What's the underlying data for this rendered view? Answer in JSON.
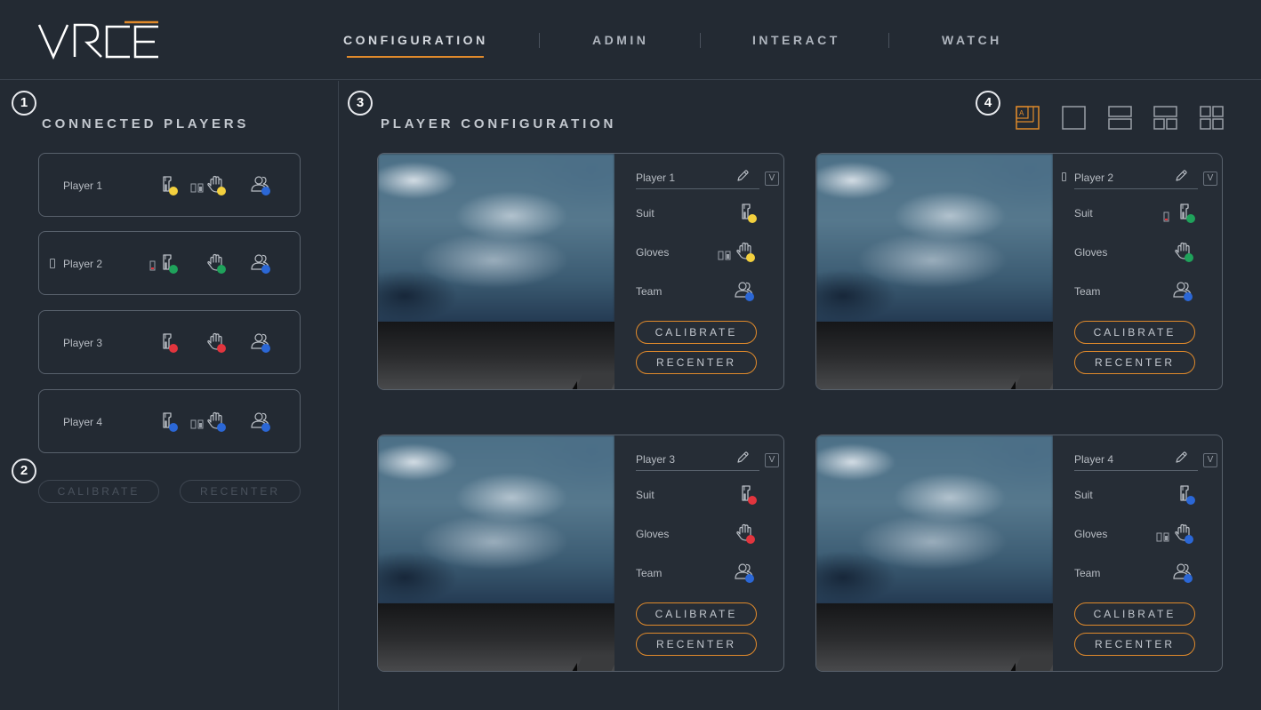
{
  "header": {
    "logo_text": "VREE",
    "nav": [
      {
        "label": "CONFIGURATION",
        "active": true
      },
      {
        "label": "ADMIN",
        "active": false
      },
      {
        "label": "INTERACT",
        "active": false
      },
      {
        "label": "WATCH",
        "active": false
      }
    ]
  },
  "steps": [
    "1",
    "2",
    "3",
    "4"
  ],
  "connected": {
    "title": "CONNECTED PLAYERS",
    "players": [
      {
        "name": "Player 1",
        "suit_status": "yellow",
        "gloves_status": "yellow",
        "team_status": "blue"
      },
      {
        "name": "Player 2",
        "suit_status": "green",
        "gloves_status": "green",
        "team_status": "blue"
      },
      {
        "name": "Player 3",
        "suit_status": "red",
        "gloves_status": "red",
        "team_status": "blue"
      },
      {
        "name": "Player 4",
        "suit_status": "blue",
        "gloves_status": "blue",
        "team_status": "blue"
      }
    ],
    "calibrate_label": "CALIBRATE",
    "recenter_label": "RECENTER"
  },
  "config": {
    "title": "PLAYER CONFIGURATION",
    "layout_icons": [
      "layout-auto-icon",
      "layout-single-icon",
      "layout-two-rows-icon",
      "layout-three-split-icon",
      "layout-quad-icon"
    ],
    "row_labels": {
      "suit": "Suit",
      "gloves": "Gloves",
      "team": "Team"
    },
    "v_label": "V",
    "calibrate_label": "CALIBRATE",
    "recenter_label": "RECENTER",
    "panels": [
      {
        "name": "Player 1"
      },
      {
        "name": "Player 2"
      },
      {
        "name": "Player 3"
      },
      {
        "name": "Player 4"
      }
    ]
  },
  "colors": {
    "accent": "#e08a2b",
    "yellow": "#f3d03e",
    "green": "#1fa25b",
    "red": "#e2353e",
    "blue": "#2b67d6"
  }
}
